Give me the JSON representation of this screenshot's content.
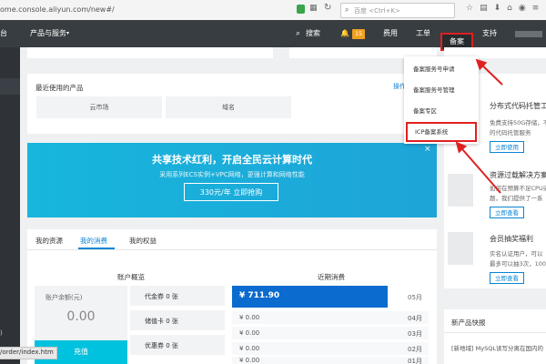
{
  "browser": {
    "url": "ome.console.aliyun.com/new#/",
    "search_placeholder": "百度 <Ctrl+K>",
    "status_url": "/order/index.htm"
  },
  "nav": {
    "left_fragment": "台",
    "products": "产品与服务",
    "search": "搜索",
    "bell_count": "15",
    "fee": "费用",
    "ticket": "工单",
    "beian": "备案",
    "support": "支持"
  },
  "recent": {
    "title": "最近使用的产品",
    "op": "操作",
    "items": [
      "云市场",
      "域名"
    ]
  },
  "beian_menu": {
    "items": [
      "备案服务号申请",
      "备案服务号管理",
      "备案专区",
      "ICP备案系统"
    ]
  },
  "banner": {
    "title": "共享技术红利，开启全民云计算时代",
    "subtitle": "采用系列ECS实例+VPC网络，更强计算和网络性能",
    "button": "330元/年 立即抢购",
    "close": "×"
  },
  "tabs": [
    "我的资源",
    "我的消费",
    "我的权益"
  ],
  "account": {
    "overview": "账户概览",
    "balance_label": "账户余额(元)",
    "balance": "0.00",
    "recharge": "充值",
    "coupons": [
      "代金券 0 张",
      "储值卡 0 张",
      "优惠券 0 张"
    ]
  },
  "recent_spend": {
    "title": "近期消费",
    "rows": [
      {
        "amount": "¥ 711.90",
        "month": "05月"
      },
      {
        "amount": "¥ 0.00",
        "month": "04月"
      },
      {
        "amount": "¥ 0.00",
        "month": "03月"
      },
      {
        "amount": "¥ 0.00",
        "month": "02月"
      },
      {
        "amount": "¥ 0.00",
        "month": "01月"
      }
    ]
  },
  "right_cards": [
    {
      "title": "分布式代码托管工",
      "desc1": "免费支持50G存储，不",
      "desc2": "的代码托管服务",
      "button": "立即使用"
    },
    {
      "title": "资源过载解决方案",
      "desc1": "如何在预算不足CPU或",
      "desc2": "题，我们提供了一系",
      "button": "立即查看"
    },
    {
      "title": "会员抽奖福利",
      "desc1": "实名认证用户，可以",
      "desc2": "最多可以抽3次，100%",
      "button": "立即查看"
    }
  ],
  "new_products": {
    "title": "新产品快报",
    "item": "[新地域] MySQL读写分离在国内的"
  }
}
